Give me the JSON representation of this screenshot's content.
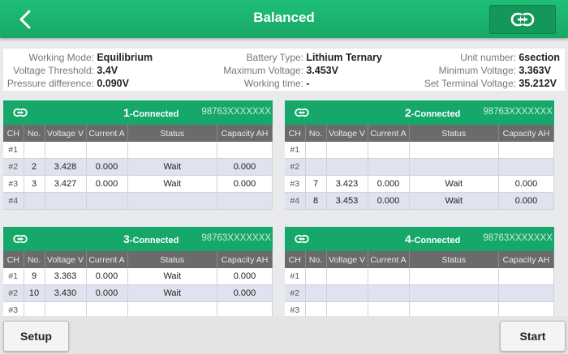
{
  "header": {
    "title": "Balanced",
    "back_icon": "chevron-left-icon",
    "link_icon": "link-icon",
    "bar_color": "#1db871"
  },
  "info": {
    "working_mode_label": "Working Mode:",
    "working_mode_value": "Equilibrium",
    "voltage_threshold_label": "Voltage Threshold:",
    "voltage_threshold_value": "3.4V",
    "pressure_difference_label": "Pressure difference:",
    "pressure_difference_value": "0.090V",
    "battery_type_label": "Battery Type:",
    "battery_type_value": "Lithium Ternary",
    "maximum_voltage_label": "Maximum Voltage:",
    "maximum_voltage_value": "3.453V",
    "working_time_label": "Working time:",
    "working_time_value": "-",
    "unit_number_label": "Unit number:",
    "unit_number_value": "6section",
    "minimum_voltage_label": "Minimum Voltage:",
    "minimum_voltage_value": "3.363V",
    "set_terminal_voltage_label": "Set Terminal Voltage:",
    "set_terminal_voltage_value": "35.212V"
  },
  "columns": [
    "CH",
    "No.",
    "Voltage V",
    "Current A",
    "Status",
    "Capacity AH"
  ],
  "panels": [
    {
      "number": "1",
      "status": "-Connected",
      "serial": "98763XXXXXXX",
      "rows": [
        {
          "ch": "#1",
          "no": "",
          "voltage": "",
          "current": "",
          "status": "",
          "capacity": ""
        },
        {
          "ch": "#2",
          "no": "2",
          "voltage": "3.428",
          "current": "0.000",
          "status": "Wait",
          "capacity": "0.000"
        },
        {
          "ch": "#3",
          "no": "3",
          "voltage": "3.427",
          "current": "0.000",
          "status": "Wait",
          "capacity": "0.000"
        },
        {
          "ch": "#4",
          "no": "",
          "voltage": "",
          "current": "",
          "status": "",
          "capacity": ""
        }
      ]
    },
    {
      "number": "2",
      "status": "-Connected",
      "serial": "98763XXXXXXX",
      "rows": [
        {
          "ch": "#1",
          "no": "",
          "voltage": "",
          "current": "",
          "status": "",
          "capacity": ""
        },
        {
          "ch": "#2",
          "no": "",
          "voltage": "",
          "current": "",
          "status": "",
          "capacity": ""
        },
        {
          "ch": "#3",
          "no": "7",
          "voltage": "3.423",
          "current": "0.000",
          "status": "Wait",
          "capacity": "0.000"
        },
        {
          "ch": "#4",
          "no": "8",
          "voltage": "3.453",
          "current": "0.000",
          "status": "Wait",
          "capacity": "0.000"
        }
      ]
    },
    {
      "number": "3",
      "status": "-Connected",
      "serial": "98763XXXXXXX",
      "rows": [
        {
          "ch": "#1",
          "no": "9",
          "voltage": "3.363",
          "current": "0.000",
          "status": "Wait",
          "capacity": "0.000"
        },
        {
          "ch": "#2",
          "no": "10",
          "voltage": "3.430",
          "current": "0.000",
          "status": "Wait",
          "capacity": "0.000"
        },
        {
          "ch": "#3",
          "no": "",
          "voltage": "",
          "current": "",
          "status": "",
          "capacity": ""
        }
      ]
    },
    {
      "number": "4",
      "status": "-Connected",
      "serial": "98763XXXXXXX",
      "rows": [
        {
          "ch": "#1",
          "no": "",
          "voltage": "",
          "current": "",
          "status": "",
          "capacity": ""
        },
        {
          "ch": "#2",
          "no": "",
          "voltage": "",
          "current": "",
          "status": "",
          "capacity": ""
        },
        {
          "ch": "#3",
          "no": "",
          "voltage": "",
          "current": "",
          "status": "",
          "capacity": ""
        }
      ]
    }
  ],
  "footer": {
    "setup_label": "Setup",
    "start_label": "Start"
  }
}
